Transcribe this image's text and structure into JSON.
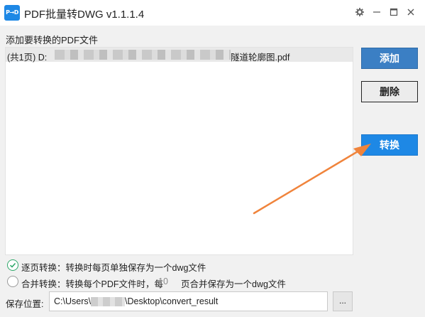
{
  "window": {
    "icon_text": "P→D",
    "title": "PDF批量转DWG  v1.1.1.4",
    "controls": [
      "settings",
      "minimize",
      "maximize",
      "close"
    ]
  },
  "file_section": {
    "label": "添加要转换的PDF文件",
    "files": [
      {
        "prefix": "(共1页) D:",
        "suffix": "隧道轮廓图.pdf",
        "redacted": true
      }
    ]
  },
  "buttons": {
    "add": "添加",
    "delete": "删除",
    "convert": "转换"
  },
  "options": {
    "per_page": {
      "label": "逐页转换：转换时每页单独保存为一个dwg文件",
      "checked": true
    },
    "merge": {
      "label_a": "合并转换：转换每个PDF文件时，每",
      "count": "10",
      "label_b": "页合并保存为一个dwg文件",
      "checked": false
    }
  },
  "save": {
    "label": "保存位置:",
    "path_a": "C:\\Users\\",
    "path_b": "\\Desktop\\convert_result",
    "browse": "..."
  },
  "colors": {
    "accent": "#1e88e5",
    "add_button": "#3b7fc4",
    "checked": "#2fa86a",
    "arrow": "#f0843c"
  }
}
